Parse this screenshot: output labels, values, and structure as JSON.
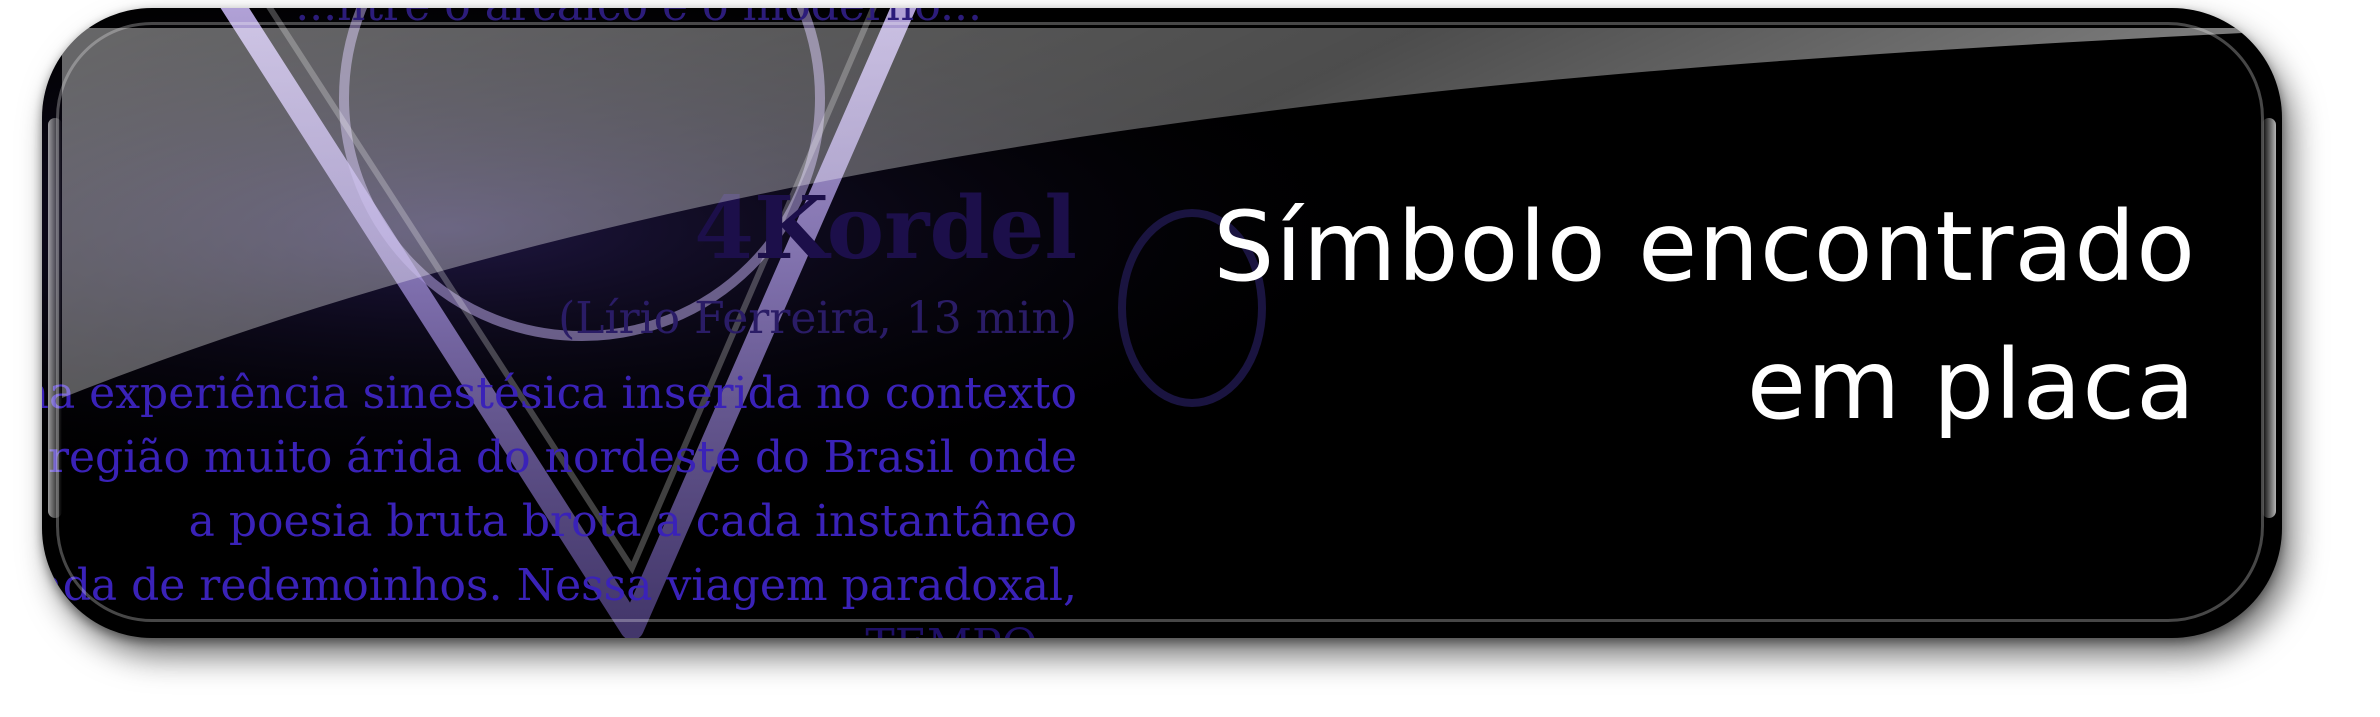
{
  "headline": {
    "line1": "Símbolo encontrado",
    "line2": "em placa"
  },
  "background_poster": {
    "top_fragment": "...ntre o arcaico e o moderno...",
    "title": "4Kordel",
    "author": "(Lírio Ferreira, 13 min)",
    "lines": [
      "uma experiência sinestésica inserida no contexto",
      "a região muito árida do nordeste do Brasil onde",
      "a poesia bruta brota a cada instantâneo",
      "lufada de redemoinhos. Nessa viagem paradoxal,",
      "TEMPO..."
    ]
  },
  "colors": {
    "plate": "#000000",
    "headline_text": "#ffffff",
    "poster_text": "#3a22b8",
    "symbol_stroke": "#b8a6e6"
  },
  "icons": {
    "symbol": "v-with-circle-symbol-icon"
  }
}
